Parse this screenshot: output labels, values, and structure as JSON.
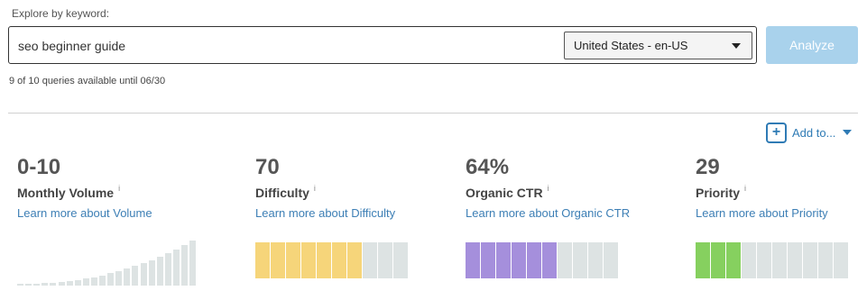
{
  "search": {
    "label": "Explore by keyword:",
    "query": "seo beginner guide",
    "locale": "United States - en-US",
    "analyze_label": "Analyze",
    "quota": "9 of 10 queries available until 06/30"
  },
  "add_to": {
    "label": "Add to..."
  },
  "metrics": [
    {
      "value": "0-10",
      "label": "Monthly Volume",
      "link": "Learn more about Volume"
    },
    {
      "value": "70",
      "label": "Difficulty",
      "link": "Learn more about Difficulty",
      "filled": 7,
      "total": 10,
      "color": "#f6d57a"
    },
    {
      "value": "64%",
      "label": "Organic CTR",
      "link": "Learn more about Organic CTR",
      "filled": 6,
      "total": 10,
      "color": "#a58fdc"
    },
    {
      "value": "29",
      "label": "Priority",
      "link": "Learn more about Priority",
      "filled": 3,
      "total": 10,
      "color": "#86d05f"
    }
  ],
  "colors": {
    "empty_segment": "#dde3e3",
    "link": "#3d7fb5",
    "analyze_bg": "#a9d2ec"
  },
  "info_icon": "i"
}
